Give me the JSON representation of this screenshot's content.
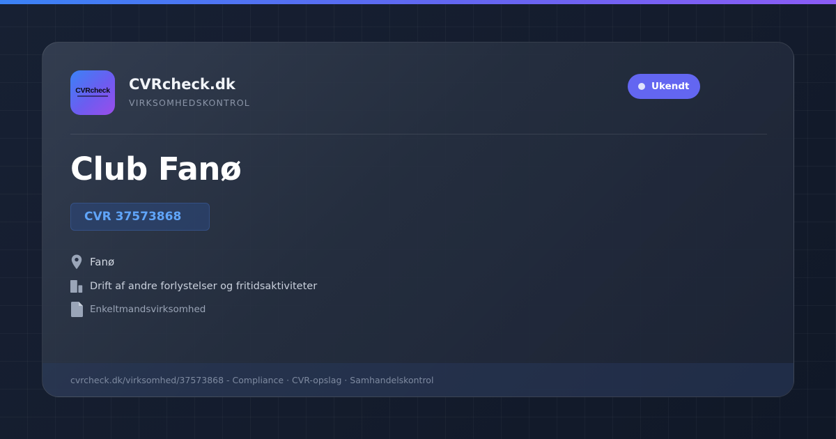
{
  "brand": {
    "logo_text": "CVRcheck",
    "name": "CVRcheck.dk",
    "tagline": "VIRKSOMHEDSKONTROL"
  },
  "status": {
    "label": "Ukendt",
    "color": "#6366f1"
  },
  "company": {
    "name": "Club Fanø",
    "cvr": "CVR 37573868",
    "location": "Fanø",
    "industry": "Drift af andre forlystelser og fritidsaktiviteter",
    "company_form": "Enkeltmandsvirksomhed"
  },
  "icons": {
    "location": "map-pin-icon",
    "industry": "building-icon",
    "company_form": "document-icon"
  },
  "footer": {
    "text": "cvrcheck.dk/virksomhed/37573868 - Compliance · CVR-opslag · Samhandelskontrol"
  },
  "colors": {
    "accent_blue": "#3b82f6",
    "accent_indigo": "#6366f1",
    "accent_violet": "#8b5cf6",
    "cvr_text": "#60a5fa",
    "background": "#131b2c"
  }
}
